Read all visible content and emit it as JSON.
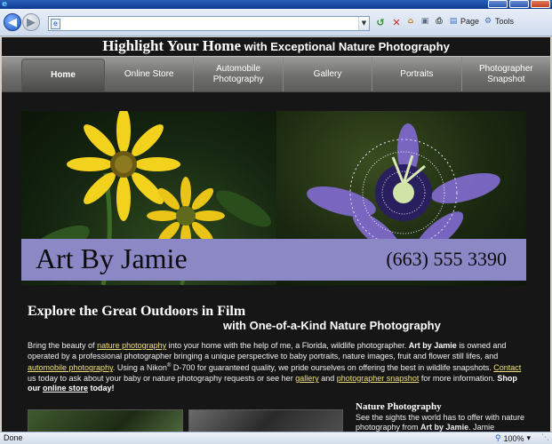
{
  "browser": {
    "address_value": "",
    "toolbar": {
      "page_label": "Page",
      "tools_label": "Tools"
    },
    "status": "Done",
    "zoom": "100%"
  },
  "header": {
    "title_main": "Highlight Your Home",
    "title_sub": " with Exceptional Nature Photography"
  },
  "nav": {
    "items": [
      {
        "label": "Home"
      },
      {
        "label": "Online Store"
      },
      {
        "label": "Automobile Photography"
      },
      {
        "label": "Gallery"
      },
      {
        "label": "Portraits"
      },
      {
        "label": "Photographer Snapshot"
      }
    ]
  },
  "hero": {
    "name": "Art By Jamie",
    "phone": "(663) 555 3390"
  },
  "content": {
    "heading": "Explore the Great Outdoors in Film",
    "subheading": "with One-of-a-Kind Nature Photography",
    "intro": {
      "p1": "Bring the beauty of ",
      "link_nature": "nature photography",
      "p2": " into your home with the help of me, a Florida, wildlife photographer. ",
      "brand": "Art by Jamie",
      "p3": " is owned and operated by a professional photographer bringing a unique perspective to baby portraits, nature images, fruit and flower still lifes, and ",
      "link_auto": "automobile photography",
      "p4": ". Using a Nikon",
      "reg": "®",
      "p5": " D-700 for guaranteed quality, we pride ourselves on offering the best in wildlife snapshots. ",
      "link_contact": "Contact",
      "p6": " us today to ask about your baby or nature photography requests or see her ",
      "link_gallery": "gallery",
      "p7": " and ",
      "link_snapshot": "photographer snapshot",
      "p8": " for more information. ",
      "shop": "Shop our ",
      "link_store": "online store",
      "today": " today!"
    },
    "nature_section": {
      "title": "Nature Photography",
      "text_a": "See the sights the world has to offer with nature photography from ",
      "text_brand": "Art by Jamie",
      "text_b": ". Jamie"
    }
  }
}
